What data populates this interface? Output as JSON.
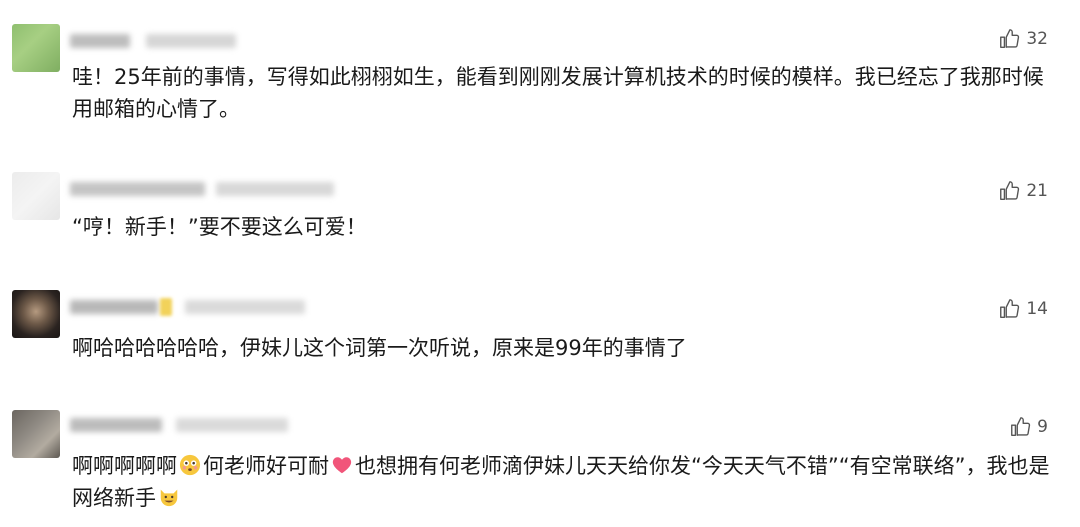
{
  "comments": [
    {
      "likes": "32",
      "text": "哇！25年前的事情，写得如此栩栩如生，能看到刚刚发展计算机技术的时候的模样。我已经忘了我那时候用邮箱的心情了。"
    },
    {
      "likes": "21",
      "text": "“哼！新手！”要不要这么可爱！"
    },
    {
      "likes": "14",
      "text": "啊哈哈哈哈哈哈，伊妹儿这个词第一次听说，原来是99年的事情了"
    },
    {
      "likes": "9",
      "text_part1": "啊啊啊啊啊",
      "text_part2": "何老师好可耐",
      "text_part3": "也想拥有何老师滴伊妹儿天天给你发“今天天气不错”“有空常联络”，我也是网络新手",
      "emoji_1": "flushed-face-icon",
      "emoji_2": "heart-icon",
      "emoji_3": "grinning-cat-icon"
    }
  ],
  "like_icon": "thumbs-up-icon"
}
